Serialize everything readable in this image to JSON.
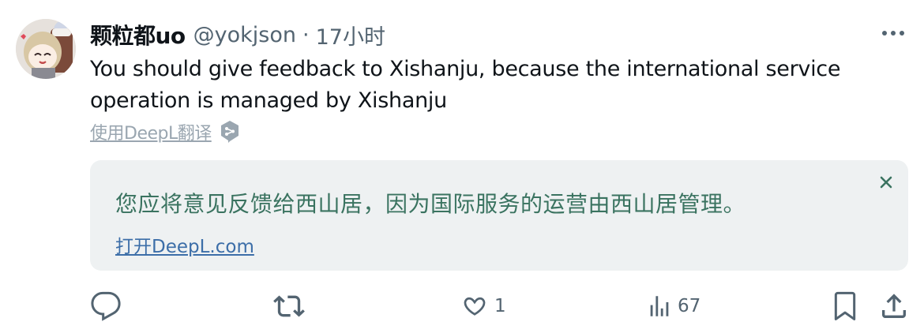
{
  "tweet": {
    "author_name": "颗粒都uo",
    "handle": "@yokjson",
    "separator": "·",
    "time": "17小时",
    "text": "You should give feedback to Xishanju, because the international service operation is managed by Xishanju",
    "translate_label": "使用DeepL翻译"
  },
  "translation": {
    "text": "您应将意见反馈给西山居，因为国际服务的运营由西山居管理。",
    "open_link": "打开DeepL.com"
  },
  "actions": {
    "reply": {
      "icon": "reply-icon",
      "count": ""
    },
    "retweet": {
      "icon": "retweet-icon",
      "count": ""
    },
    "like": {
      "icon": "heart-icon",
      "count": "1"
    },
    "views": {
      "icon": "views-icon",
      "count": "67"
    },
    "bookmark": {
      "icon": "bookmark-icon"
    },
    "share": {
      "icon": "share-icon"
    }
  },
  "colors": {
    "text": "#0f1419",
    "secondary": "#536471",
    "translation_text": "#3a7360",
    "translation_bg": "#eef1f2",
    "link": "#3c6ea8"
  }
}
